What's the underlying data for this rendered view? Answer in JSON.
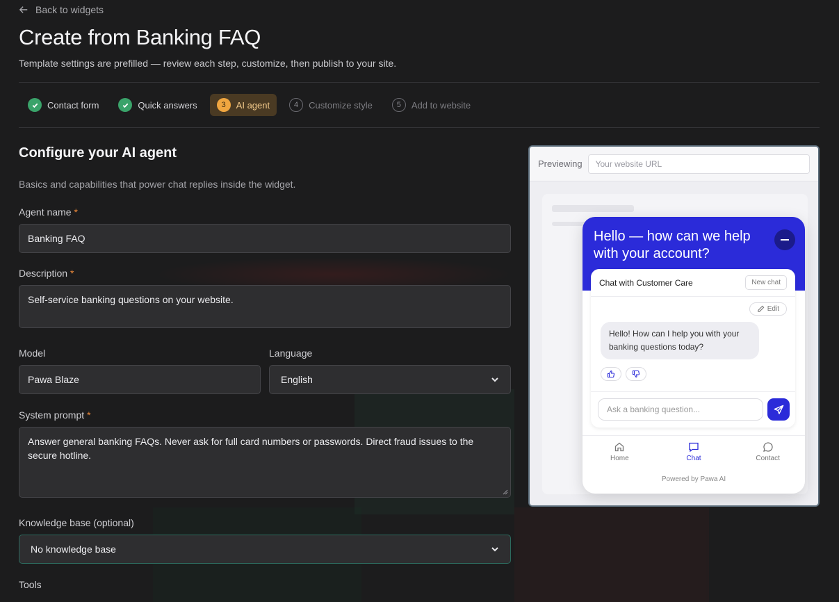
{
  "nav": {
    "back_label": "Back to widgets"
  },
  "header": {
    "title": "Create from Banking FAQ",
    "subtitle": "Template settings are prefilled — review each step, customize, then publish to your site."
  },
  "steps": [
    {
      "num": "1",
      "label": "Contact form",
      "status": "done"
    },
    {
      "num": "2",
      "label": "Quick answers",
      "status": "done"
    },
    {
      "num": "3",
      "label": "AI agent",
      "status": "active"
    },
    {
      "num": "4",
      "label": "Customize style",
      "status": "pending"
    },
    {
      "num": "5",
      "label": "Add to website",
      "status": "pending"
    }
  ],
  "form": {
    "title": "Configure your AI agent",
    "subtitle": "Basics and capabilities that power chat replies inside the widget.",
    "required_mark": "*",
    "agent_name": {
      "label": "Agent name",
      "value": "Banking FAQ"
    },
    "description": {
      "label": "Description",
      "value": "Self-service banking questions on your website."
    },
    "model": {
      "label": "Model",
      "value": "Pawa Blaze"
    },
    "language": {
      "label": "Language",
      "value": "English"
    },
    "system_prompt": {
      "label": "System prompt",
      "value": "Answer general banking FAQs. Never ask for full card numbers or passwords. Direct fraud issues to the secure hotline."
    },
    "knowledge_base": {
      "label": "Knowledge base (optional)",
      "value": "No knowledge base"
    },
    "tools": {
      "label": "Tools"
    }
  },
  "preview": {
    "label": "Previewing",
    "url_placeholder": "Your website URL",
    "widget": {
      "title": "Hello — how can we help with your account?",
      "chat_title": "Chat with Customer Care",
      "new_chat": "New chat",
      "edit": "Edit",
      "bot_message": "Hello! How can I help you with your banking questions today?",
      "input_placeholder": "Ask a banking question...",
      "nav": {
        "home": "Home",
        "chat": "Chat",
        "contact": "Contact"
      },
      "powered_by": "Powered by Pawa AI",
      "accent_color": "#2b2bd9"
    }
  },
  "colors": {
    "step_active_bg": "#4a3a23",
    "step_active_badge": "#f0a640",
    "done_check": "#3aa36a",
    "required": "#e8873a"
  }
}
